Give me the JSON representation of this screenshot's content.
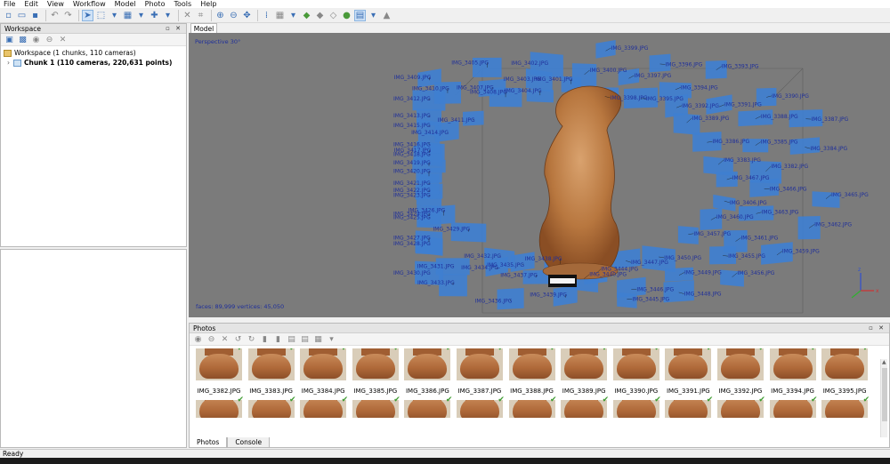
{
  "menu": [
    "File",
    "Edit",
    "View",
    "Workflow",
    "Model",
    "Photo",
    "Tools",
    "Help"
  ],
  "workspace": {
    "title": "Workspace",
    "root_label": "Workspace (1 chunks, 110 cameras)",
    "chunk_label": "Chunk 1 (110 cameras, 220,631 points)"
  },
  "model": {
    "tab": "Model",
    "perspective": "Perspective 30°",
    "stats": "faces: 89,999 vertices: 45,050",
    "camera_labels": [
      "IMG_3467.JPG",
      "IMG_3466.JPG",
      "IMG_3465.JPG",
      "IMG_3406.JPG",
      "IMG_3463.JPG",
      "IMG_3462.JPG",
      "IMG_3460.JPG",
      "IMG_3461.JPG",
      "IMG_3459.JPG",
      "IMG_3457.JPG",
      "IMG_3455.JPG",
      "IMG_3456.JPG",
      "IMG_3450.JPG",
      "IMG_3449.JPG",
      "IMG_3448.JPG",
      "IMG_3447.JPG",
      "IMG_3446.JPG",
      "IMG_3445.JPG",
      "IMG_3444.JPG",
      "IMG_3440.JPG",
      "IMG_3439.JPG",
      "IMG_3438.JPG",
      "IMG_3437.JPG",
      "IMG_3436.JPG",
      "IMG_3435.JPG",
      "IMG_3434.JPG",
      "IMG_3433.JPG",
      "IMG_3432.JPG",
      "IMG_3431.JPG",
      "IMG_3430.JPG",
      "IMG_3429.JPG",
      "IMG_3428.JPG",
      "IMG_3427.JPG",
      "IMG_3426.JPG",
      "IMG_3425.JPG",
      "IMG_3424.JPG",
      "IMG_3423.JPG",
      "IMG_3422.JPG",
      "IMG_3421.JPG",
      "IMG_3420.JPG",
      "IMG_3419.JPG",
      "IMG_3418.JPG",
      "IMG_3417.JPG",
      "IMG_3416.JPG",
      "IMG_3415.JPG",
      "IMG_3414.JPG",
      "IMG_3413.JPG",
      "IMG_3412.JPG",
      "IMG_3411.JPG",
      "IMG_3410.JPG",
      "IMG_3409.JPG",
      "IMG_3408.JPG",
      "IMG_3407.JPG",
      "IMG_3405.JPG",
      "IMG_3404.JPG",
      "IMG_3403.JPG",
      "IMG_3402.JPG",
      "IMG_3401.JPG",
      "IMG_3400.JPG",
      "IMG_3399.JPG",
      "IMG_3398.JPG",
      "IMG_3397.JPG",
      "IMG_3396.JPG",
      "IMG_3395.JPG",
      "IMG_3394.JPG",
      "IMG_3393.JPG",
      "IMG_3392.JPG",
      "IMG_3391.JPG",
      "IMG_3390.JPG",
      "IMG_3389.JPG",
      "IMG_3388.JPG",
      "IMG_3387.JPG",
      "IMG_3386.JPG",
      "IMG_3385.JPG",
      "IMG_3384.JPG",
      "IMG_3383.JPG",
      "IMG_3382.JPG"
    ]
  },
  "photos": {
    "title": "Photos",
    "row1": [
      "IMG_3382.JPG",
      "IMG_3383.JPG",
      "IMG_3384.JPG",
      "IMG_3385.JPG",
      "IMG_3386.JPG",
      "IMG_3387.JPG",
      "IMG_3388.JPG",
      "IMG_3389.JPG",
      "IMG_3390.JPG",
      "IMG_3391.JPG",
      "IMG_3392.JPG",
      "IMG_3394.JPG",
      "IMG_3395.JPG"
    ],
    "row2_count": 13
  },
  "tabs": [
    "Photos",
    "Console"
  ],
  "status": "Ready",
  "colors": {
    "camera_plane": "#3f7fd0",
    "viewport_bg": "#7b7b7b",
    "label_text": "#1f2f9a",
    "check": "#3c9a2e"
  }
}
